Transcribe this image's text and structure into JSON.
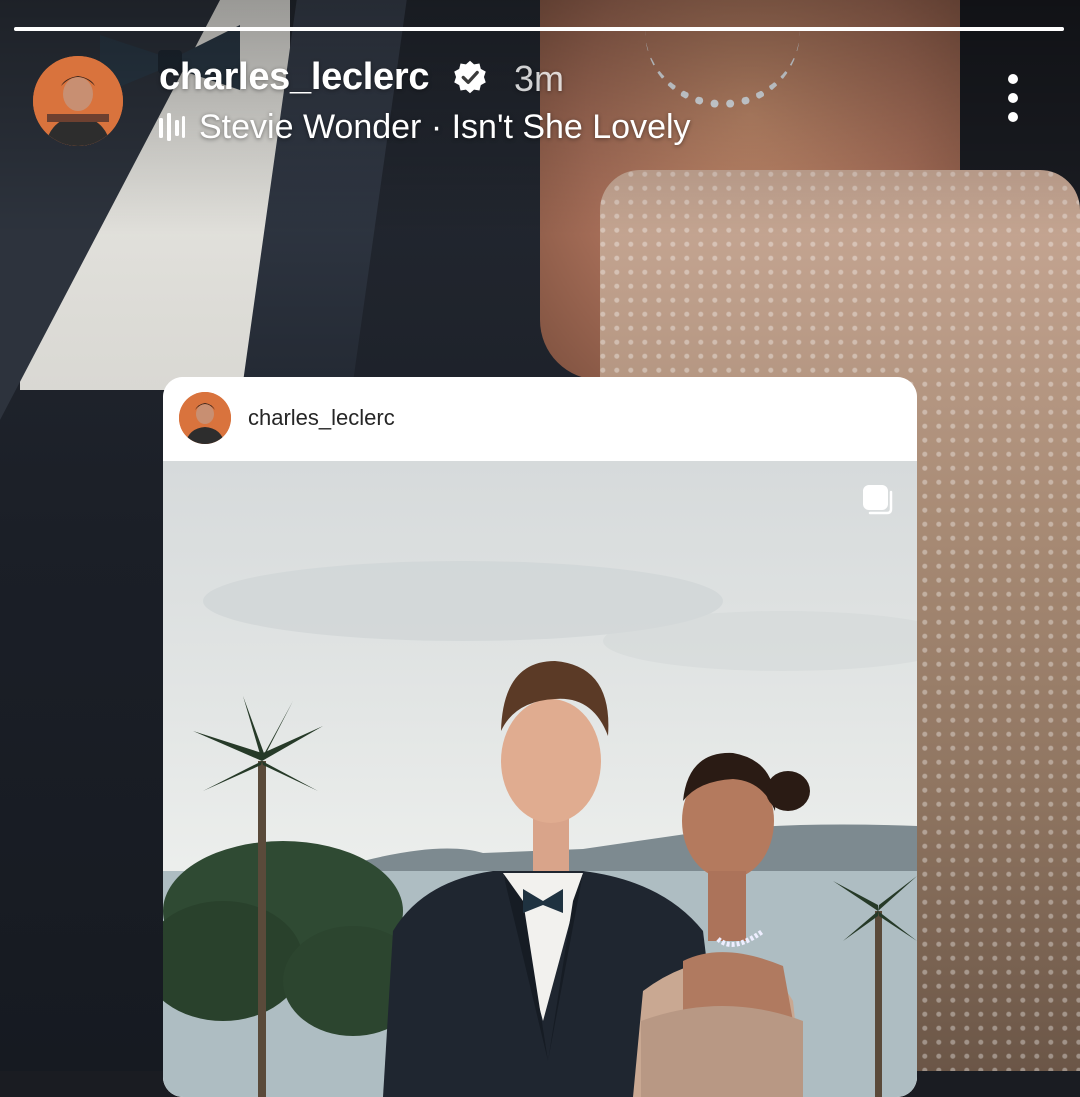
{
  "story": {
    "progress_fraction": 1.0,
    "username": "charles_leclerc",
    "verified": true,
    "time_ago": "3m",
    "music": "Stevie Wonder · Isn't She Lovely",
    "icons": {
      "verified": "verified-badge-icon",
      "music": "music-bars-icon",
      "more": "more-vertical-icon"
    }
  },
  "embedded_post": {
    "username": "charles_leclerc",
    "icons": {
      "multi": "carousel-multiple-icon"
    }
  }
}
